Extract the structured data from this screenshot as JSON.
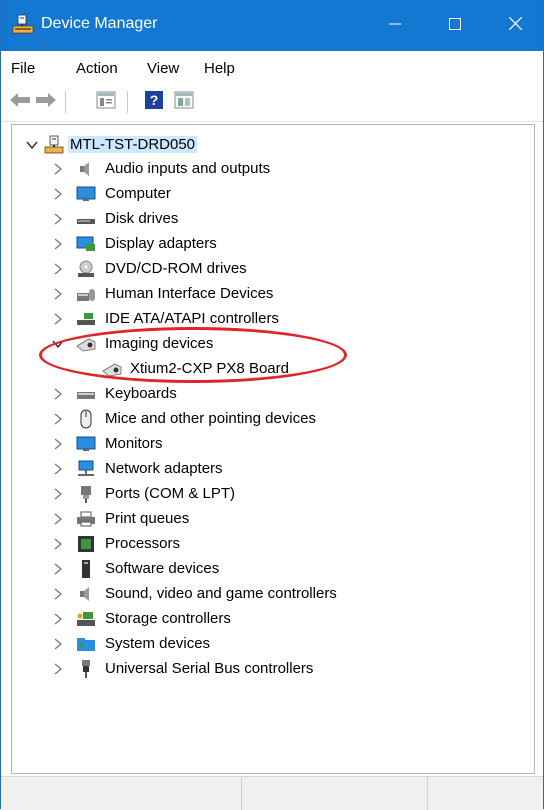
{
  "window": {
    "title": "Device Manager",
    "icons": {
      "app": "device-manager-icon",
      "minimize": "minimize-icon",
      "maximize": "maximize-icon",
      "close": "close-icon"
    },
    "title_bar_color": "#1477d2"
  },
  "menu": [
    "File",
    "Action",
    "View",
    "Help"
  ],
  "toolbar": {
    "buttons": [
      "back-arrow-icon",
      "forward-arrow-icon",
      "properties-icon",
      "help-icon",
      "show-hidden-icon"
    ]
  },
  "tree": {
    "root": {
      "label": "MTL-TST-DRD050",
      "expanded": true,
      "icon": "computer-network-icon"
    },
    "items": [
      {
        "label": "Audio inputs and outputs",
        "icon": "speaker-icon",
        "expanded": false
      },
      {
        "label": "Computer",
        "icon": "monitor-icon",
        "expanded": false
      },
      {
        "label": "Disk drives",
        "icon": "disk-drive-icon",
        "expanded": false
      },
      {
        "label": "Display adapters",
        "icon": "display-adapter-icon",
        "expanded": false
      },
      {
        "label": "DVD/CD-ROM drives",
        "icon": "dvd-icon",
        "expanded": false
      },
      {
        "label": "Human Interface Devices",
        "icon": "hid-icon",
        "expanded": false
      },
      {
        "label": "IDE ATA/ATAPI controllers",
        "icon": "ide-controller-icon",
        "expanded": false
      },
      {
        "label": "Imaging devices",
        "icon": "camera-icon",
        "expanded": true,
        "children": [
          {
            "label": "Xtium2-CXP PX8 Board",
            "icon": "camera-icon"
          }
        ]
      },
      {
        "label": "Keyboards",
        "icon": "keyboard-icon",
        "expanded": false
      },
      {
        "label": "Mice and other pointing devices",
        "icon": "mouse-icon",
        "expanded": false
      },
      {
        "label": "Monitors",
        "icon": "monitor-icon",
        "expanded": false
      },
      {
        "label": "Network adapters",
        "icon": "network-icon",
        "expanded": false
      },
      {
        "label": "Ports (COM & LPT)",
        "icon": "port-icon",
        "expanded": false
      },
      {
        "label": "Print queues",
        "icon": "printer-icon",
        "expanded": false
      },
      {
        "label": "Processors",
        "icon": "processor-icon",
        "expanded": false
      },
      {
        "label": "Software devices",
        "icon": "software-device-icon",
        "expanded": false
      },
      {
        "label": "Sound, video and game controllers",
        "icon": "speaker-icon",
        "expanded": false
      },
      {
        "label": "Storage controllers",
        "icon": "storage-controller-icon",
        "expanded": false
      },
      {
        "label": "System devices",
        "icon": "system-folder-icon",
        "expanded": false
      },
      {
        "label": "Universal Serial Bus controllers",
        "icon": "usb-icon",
        "expanded": false
      }
    ]
  },
  "annotation": {
    "color": "#e0262c",
    "highlights": "Imaging devices"
  }
}
